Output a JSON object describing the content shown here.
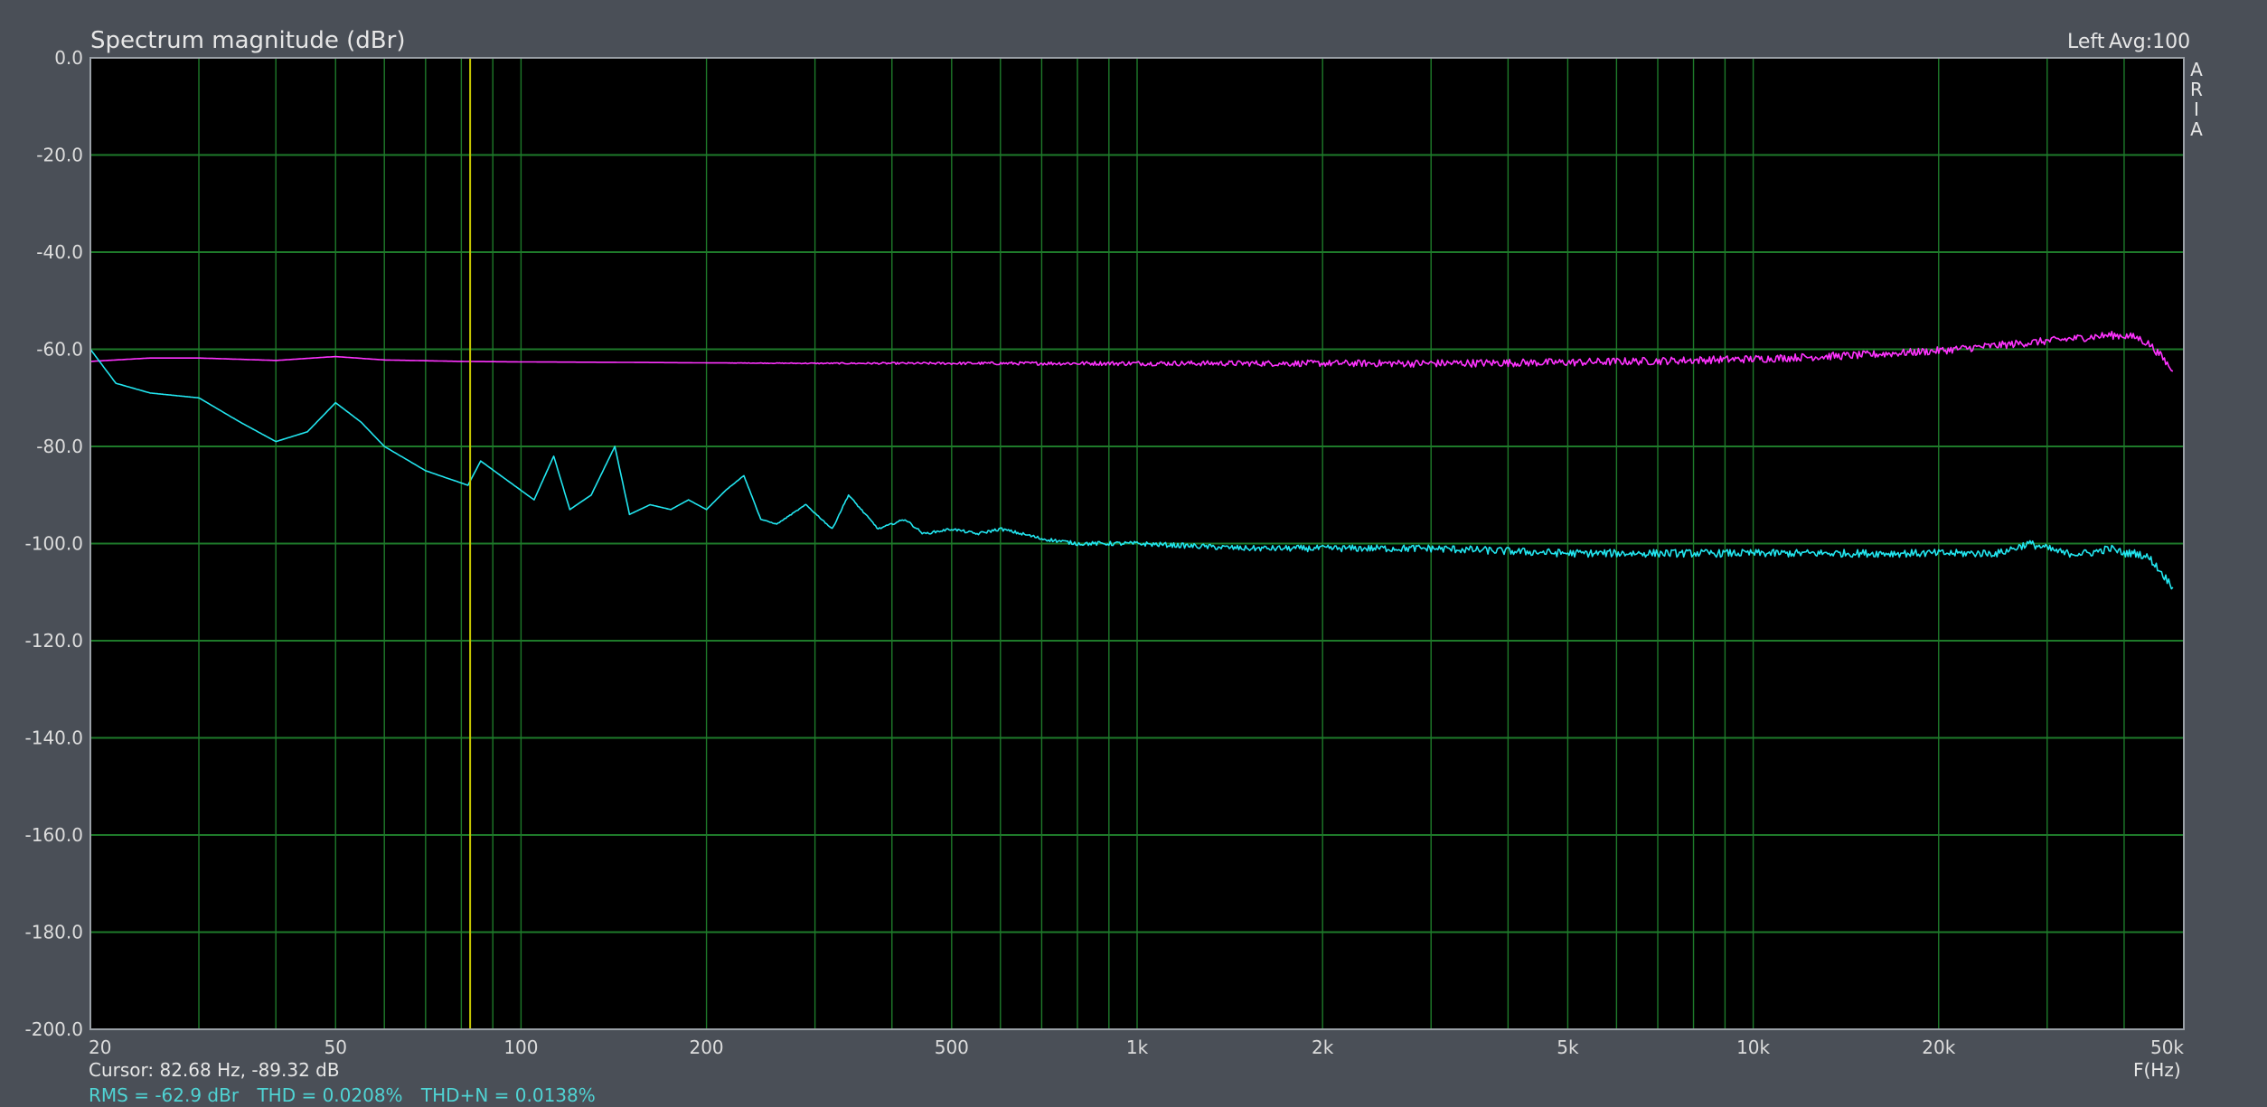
{
  "header": {
    "title": "Spectrum magnitude (dBr)",
    "channel": "Left",
    "averages": "Avg:100",
    "side_tags": [
      "A",
      "R",
      "I",
      "A"
    ]
  },
  "footer": {
    "cursor_readout": "Cursor: 82.68 Hz, -89.32 dB",
    "rms": "RMS = -62.9 dBr",
    "thd": "THD = 0.0208%",
    "thdn": "THD+N = 0.0138%",
    "x_unit": "F(Hz)"
  },
  "colors": {
    "plot_background": "#000000",
    "grid": "#1e7a2a",
    "cursor": "#c8c800",
    "series_signal": "#ff33ff",
    "series_noise": "#22e6f0",
    "frame": "#4a4f57"
  },
  "chart_data": {
    "type": "line",
    "title": "Spectrum magnitude (dBr)",
    "xlabel": "F(Hz)",
    "ylabel": "",
    "x_scale": "log",
    "xlim": [
      20,
      50000
    ],
    "ylim": [
      -200,
      0
    ],
    "grid": true,
    "x_ticks": [
      20,
      50,
      100,
      200,
      500,
      1000,
      2000,
      5000,
      10000,
      20000,
      50000
    ],
    "x_tick_labels": [
      "20",
      "50",
      "100",
      "200",
      "500",
      "1k",
      "2k",
      "5k",
      "10k",
      "20k",
      "50k"
    ],
    "y_ticks": [
      0,
      -20,
      -40,
      -60,
      -80,
      -100,
      -120,
      -140,
      -160,
      -180,
      -200
    ],
    "y_tick_labels": [
      "0.0",
      "-20.0",
      "-40.0",
      "-60.0",
      "-80.0",
      "-100.0",
      "-120.0",
      "-140.0",
      "-160.0",
      "-180.0",
      "-200.0"
    ],
    "cursor_x": 82.68,
    "series": [
      {
        "key": "signal",
        "x": [
          20,
          25,
          30,
          40,
          50,
          60,
          80,
          100,
          150,
          200,
          300,
          500,
          700,
          1000,
          2000,
          3000,
          5000,
          7000,
          10000,
          15000,
          20000,
          25000,
          30000,
          35000,
          38000,
          40000,
          42000,
          44000,
          46000,
          48000
        ],
        "y": [
          -62.5,
          -61.8,
          -61.8,
          -62.3,
          -61.5,
          -62.2,
          -62.5,
          -62.6,
          -62.7,
          -62.8,
          -62.9,
          -62.9,
          -62.9,
          -62.9,
          -62.9,
          -62.9,
          -62.7,
          -62.4,
          -62.0,
          -61.2,
          -60.3,
          -59.2,
          -58.3,
          -57.5,
          -57.1,
          -57.2,
          -57.6,
          -59.0,
          -61.5,
          -64.5
        ]
      },
      {
        "key": "noise",
        "x": [
          20,
          22,
          25,
          30,
          35,
          40,
          45,
          50,
          55,
          60,
          70,
          82,
          86,
          95,
          105,
          113,
          120,
          130,
          142,
          150,
          162,
          175,
          187,
          200,
          215,
          230,
          245,
          260,
          290,
          320,
          340,
          380,
          420,
          450,
          500,
          550,
          600,
          650,
          700,
          800,
          900,
          1000,
          1500,
          2000,
          3000,
          5000,
          7000,
          10000,
          15000,
          20000,
          25000,
          28000,
          30000,
          32000,
          35000,
          38000,
          40000,
          42000,
          44000,
          46000,
          48000
        ],
        "y": [
          -60,
          -67,
          -69,
          -70,
          -75,
          -79,
          -77,
          -71,
          -75,
          -80,
          -85,
          -88,
          -83,
          -87,
          -91,
          -82,
          -93,
          -90,
          -80,
          -94,
          -92,
          -93,
          -91,
          -93,
          -89,
          -86,
          -95,
          -96,
          -92,
          -97,
          -90,
          -97,
          -95,
          -98,
          -97,
          -98,
          -97,
          -98,
          -99,
          -100,
          -100,
          -100,
          -101,
          -101,
          -101,
          -102,
          -102,
          -102,
          -102,
          -102,
          -102,
          -100,
          -101,
          -102,
          -102,
          -101,
          -102,
          -102,
          -103,
          -106,
          -109
        ]
      }
    ]
  }
}
